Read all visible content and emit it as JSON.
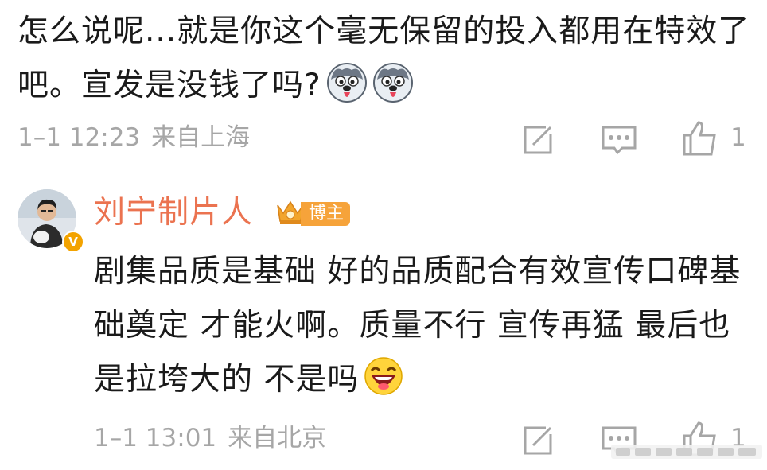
{
  "comment1": {
    "text": "怎么说呢...就是你这个毫无保留的投入都用在特效了吧。宣发是没钱了吗?",
    "emojis": [
      "husky-doge-emoji",
      "husky-doge-emoji"
    ],
    "time": "1–1 12:23",
    "location": "来自上海",
    "like_count": "1"
  },
  "reply": {
    "username": "刘宁制片人",
    "badge_label": "博主",
    "avatar_verified_icon": "verified-v-icon",
    "text": "剧集品质是基础 好的品质配合有效宣传口碑基础奠定 才能火啊。质量不行 宣传再猛 最后也是拉垮大的 不是吗",
    "emoji": "laughing-emoji",
    "time": "1–1 13:01",
    "location": "来自北京",
    "like_count": "1"
  },
  "colors": {
    "username": "#eb7350",
    "meta": "#a6a6a6",
    "badge": "#f6a33a",
    "verified": "#f3a300"
  },
  "icons": [
    "share-icon",
    "comment-icon",
    "like-icon"
  ]
}
